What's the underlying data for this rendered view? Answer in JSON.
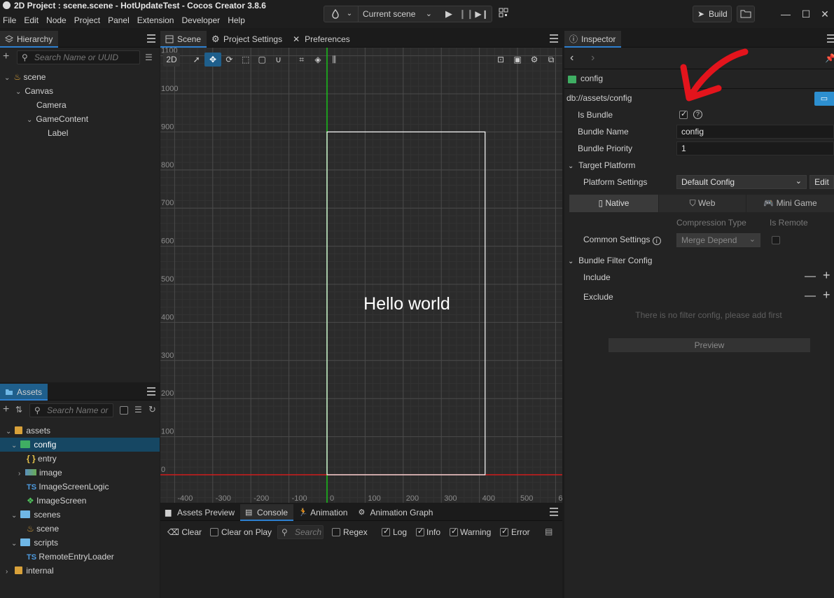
{
  "window": {
    "title": "2D Project : scene.scene - HotUpdateTest - Cocos Creator 3.8.6"
  },
  "menu": [
    "File",
    "Edit",
    "Node",
    "Project",
    "Panel",
    "Extension",
    "Developer",
    "Help"
  ],
  "toolbar": {
    "scene_select": "Current scene",
    "build_label": "Build"
  },
  "hierarchy": {
    "tab": "Hierarchy",
    "search_placeholder": "Search Name or UUID",
    "nodes": [
      "scene",
      "Canvas",
      "Camera",
      "GameContent",
      "Label"
    ]
  },
  "scene_tabs": [
    "Scene",
    "Project Settings",
    "Preferences"
  ],
  "scene": {
    "mode_label": "2D",
    "hello_text": "Hello world",
    "y_ticks": [
      "1100",
      "1000",
      "900",
      "800",
      "700",
      "600",
      "500",
      "400",
      "300",
      "200",
      "100",
      "0"
    ],
    "x_ticks": [
      "-400",
      "-300",
      "-200",
      "-100",
      "0",
      "100",
      "200",
      "300",
      "400",
      "500",
      "6"
    ]
  },
  "assets": {
    "tab": "Assets",
    "search_placeholder": "Search Name or",
    "items": [
      "assets",
      "config",
      "entry",
      "image",
      "ImageScreenLogic",
      "ImageScreen",
      "scenes",
      "scene",
      "scripts",
      "RemoteEntryLoader",
      "internal"
    ]
  },
  "bottom_tabs": [
    "Assets Preview",
    "Console",
    "Animation",
    "Animation Graph"
  ],
  "console": {
    "clear": "Clear",
    "clear_on_play": "Clear on Play",
    "search_placeholder": "Search",
    "regex": "Regex",
    "log": "Log",
    "info": "Info",
    "warning": "Warning",
    "error": "Error"
  },
  "inspector": {
    "tab": "Inspector",
    "asset_name": "config",
    "path": "db://assets/config",
    "is_bundle_label": "Is Bundle",
    "bundle_name_label": "Bundle Name",
    "bundle_name_value": "config",
    "bundle_priority_label": "Bundle Priority",
    "bundle_priority_value": "1",
    "target_platform": "Target Platform",
    "platform_settings_label": "Platform Settings",
    "platform_settings_value": "Default Config",
    "edit_label": "Edit",
    "platform_tabs": [
      "Native",
      "Web",
      "Mini Game"
    ],
    "compression_type_header": "Compression Type",
    "is_remote_header": "Is Remote",
    "common_settings_label": "Common Settings",
    "compression_value": "Merge Depend",
    "bundle_filter_config": "Bundle Filter Config",
    "include_label": "Include",
    "exclude_label": "Exclude",
    "empty_filter_text": "There is no filter config, please add first",
    "preview_label": "Preview"
  },
  "colors": {
    "accent": "#2d7fcf",
    "selected_row": "#164763",
    "folder": "#d8a13a",
    "bundle_folder": "#3fae63",
    "annotation_arrow": "#e3141c",
    "y_axis": "#19c21a",
    "x_axis": "#cf1d1d"
  }
}
